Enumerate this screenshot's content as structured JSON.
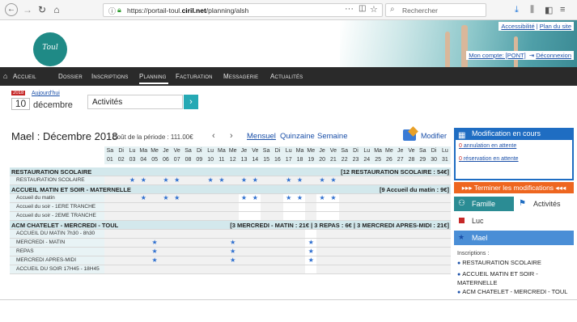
{
  "browser": {
    "url_prefix": "https://portail-toul.",
    "url_domain": "ciril.net",
    "url_path": "/planning/alsh",
    "search_placeholder": "Rechercher"
  },
  "banner": {
    "logo_text": "Toul",
    "accessibility": "Accessibilité",
    "separator": "|",
    "sitemap": "Plan du site",
    "account_label": "Mon compte: [PONT]",
    "logout": "Déconnexion"
  },
  "nav": {
    "items": [
      "Accueil",
      "Dossier",
      "Inscriptions",
      "Planning",
      "Facturation",
      "Messagerie",
      "Actualités"
    ],
    "active": "Planning"
  },
  "date_selector": {
    "year": "2018",
    "today": "Aujourd'hui",
    "day": "10",
    "month": "décembre",
    "activity_label": "Activités"
  },
  "planning": {
    "title": "Mael : Décembre 2018",
    "cost": "- Coût de la période : 111.00€",
    "views": [
      "Mensuel",
      "Quinzaine",
      "Semaine"
    ],
    "modify": "Modifier",
    "weekday_letters": [
      "Sa",
      "Di",
      "Lu",
      "Ma",
      "Me",
      "Je",
      "Ve",
      "Sa",
      "Di",
      "Lu",
      "Ma",
      "Me",
      "Je",
      "Ve",
      "Sa",
      "Di",
      "Lu",
      "Ma",
      "Me",
      "Je",
      "Ve",
      "Sa",
      "Di",
      "Lu",
      "Ma",
      "Me",
      "Je",
      "Ve",
      "Sa",
      "Di",
      "Lu"
    ],
    "day_numbers": [
      "01",
      "02",
      "03",
      "04",
      "05",
      "06",
      "07",
      "08",
      "09",
      "10",
      "11",
      "12",
      "13",
      "14",
      "15",
      "16",
      "17",
      "18",
      "19",
      "20",
      "21",
      "22",
      "23",
      "24",
      "25",
      "26",
      "27",
      "28",
      "29",
      "30",
      "31"
    ],
    "sections": [
      {
        "label": "RESTAURATION SCOLAIRE",
        "summary": "[12 RESTAURATION SCOLAIRE : 54€]",
        "rows": [
          {
            "label": "RESTAURATION SCOLAIRE",
            "starred_days": [
              3,
              4,
              6,
              7,
              10,
              11,
              13,
              14,
              17,
              18,
              20,
              21
            ],
            "white_days": []
          }
        ]
      },
      {
        "label": "ACCUEIL MATIN ET SOIR - MATERNELLE",
        "summary": "[9 Accueil du matin : 9€]",
        "rows": [
          {
            "label": "Accueil du matin",
            "starred_days": [
              4,
              6,
              7,
              13,
              14,
              17,
              18,
              20,
              21
            ],
            "white_days": [
              13,
              14,
              17,
              18,
              20,
              21
            ]
          },
          {
            "label": "Accueil du soir - 1ERE TRANCHE",
            "starred_days": [],
            "white_days": [
              13,
              14,
              17,
              18,
              20,
              21
            ]
          },
          {
            "label": "Accueil du soir - 2EME TRANCHE",
            "starred_days": [],
            "white_days": [
              13,
              14,
              17,
              18,
              20,
              21
            ]
          }
        ]
      },
      {
        "label": "ACM CHATELET - MERCREDI - TOUL",
        "summary": "[3 MERCREDI - MATIN : 21€ | 3 REPAS : 6€ | 3 MERCREDI APRES-MIDI : 21€]",
        "rows": [
          {
            "label": "ACCUEIL DU MATIN 7h30 - 8h30",
            "starred_days": [],
            "white_days": [
              19
            ]
          },
          {
            "label": "MERCREDI - MATIN",
            "starred_days": [
              5,
              12,
              19
            ],
            "white_days": [
              19
            ]
          },
          {
            "label": "REPAS",
            "starred_days": [
              5,
              12,
              19
            ],
            "white_days": [
              19
            ]
          },
          {
            "label": "MERCREDI APRES-MIDI",
            "starred_days": [
              5,
              12,
              19
            ],
            "white_days": [
              19
            ]
          },
          {
            "label": "ACCUEIL DU SOIR 17H45 - 18H45",
            "starred_days": [],
            "white_days": [
              19
            ]
          }
        ]
      }
    ]
  },
  "panel": {
    "modif_title": "Modification en cours",
    "annulation_count": "0",
    "annulation_text": " annulation en attente",
    "reservation_count": "0",
    "reservation_text": " réservation en attente",
    "finish": "▸▸▸ Terminer les modifications ◂◂◂",
    "tab_famille": "Famille",
    "tab_activites": "Activités",
    "child_1": "Luc",
    "child_2": "Mael",
    "inscriptions_title": "Inscriptions :",
    "inscriptions": [
      "RESTAURATION SCOLAIRE",
      "ACCUEIL MATIN ET SOIR - MATERNELLE",
      "ACM CHATELET - MERCREDI - TOUL"
    ]
  },
  "colors": {
    "accent": "#26a9b4",
    "star": "#2e6fcf",
    "section_bg": "#d3e8ec",
    "orange": "#ee6620",
    "panel_blue": "#1f6dc2"
  }
}
